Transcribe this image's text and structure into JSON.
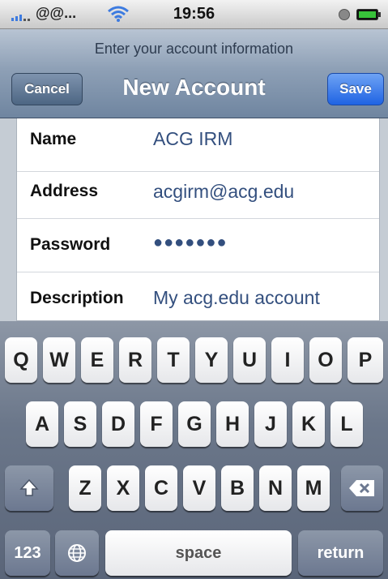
{
  "status_bar": {
    "carrier": "@@...",
    "time": "19:56"
  },
  "nav": {
    "prompt": "Enter your account information",
    "title": "New Account",
    "cancel_label": "Cancel",
    "save_label": "Save"
  },
  "form": {
    "fields": [
      {
        "label": "Name",
        "value": "ACG IRM"
      },
      {
        "label": "Address",
        "value": "acgirm@acg.edu"
      },
      {
        "label": "Password",
        "value": "●●●●●●●"
      },
      {
        "label": "Description",
        "value": "My acg.edu account"
      }
    ]
  },
  "keyboard": {
    "row1": [
      "Q",
      "W",
      "E",
      "R",
      "T",
      "Y",
      "U",
      "I",
      "O",
      "P"
    ],
    "row2": [
      "A",
      "S",
      "D",
      "F",
      "G",
      "H",
      "J",
      "K",
      "L"
    ],
    "row3": [
      "Z",
      "X",
      "C",
      "V",
      "B",
      "N",
      "M"
    ],
    "numbers_label": "123",
    "space_label": "space",
    "return_label": "return"
  },
  "colors": {
    "value_text": "#334f7e",
    "save_button": "#2a6ee8",
    "nav_bar": "#8ea0b6"
  },
  "icons": [
    "signal-icon",
    "wifi-icon",
    "lock-icon",
    "battery-icon",
    "shift-icon",
    "globe-icon",
    "backspace-icon"
  ]
}
